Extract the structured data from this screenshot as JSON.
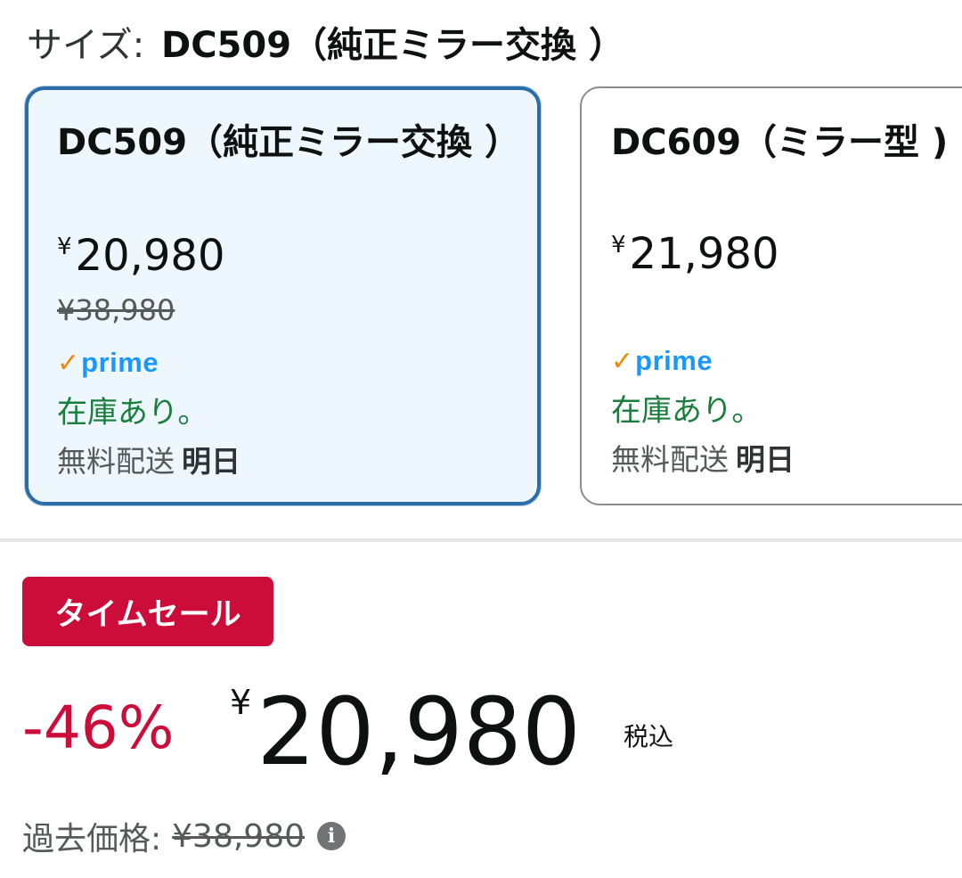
{
  "size_selector": {
    "label": "サイズ:",
    "selected_value": "DC509（純正ミラー交換 ）"
  },
  "options": [
    {
      "name": "DC509（純正ミラー交換 ）",
      "yen": "¥",
      "price": "20,980",
      "list_price": "¥38,980",
      "prime_check": "✓",
      "prime": "prime",
      "stock": "在庫あり。",
      "delivery": "無料配送",
      "delivery_day": "明日",
      "selected": true
    },
    {
      "name": "DC609（ミラー型 )",
      "yen": "¥",
      "price": "21,980",
      "prime_check": "✓",
      "prime": "prime",
      "stock": "在庫あり。",
      "delivery": "無料配送",
      "delivery_day": "明日",
      "selected": false
    }
  ],
  "deal": {
    "badge": "タイムセール",
    "discount": "-46%",
    "yen": "¥",
    "price": "20,980",
    "tax_note": "税込",
    "past_label": "過去価格:",
    "past_price": "¥38,980",
    "info_glyph": "i"
  },
  "colors": {
    "deal_red": "#cc0c39",
    "selected_border": "#2b6da8",
    "in_stock_green": "#1a7d3c",
    "prime_blue": "#1a98ff",
    "prime_check_orange": "#f08804"
  },
  "icons": [
    "prime-check-icon",
    "info-icon"
  ]
}
